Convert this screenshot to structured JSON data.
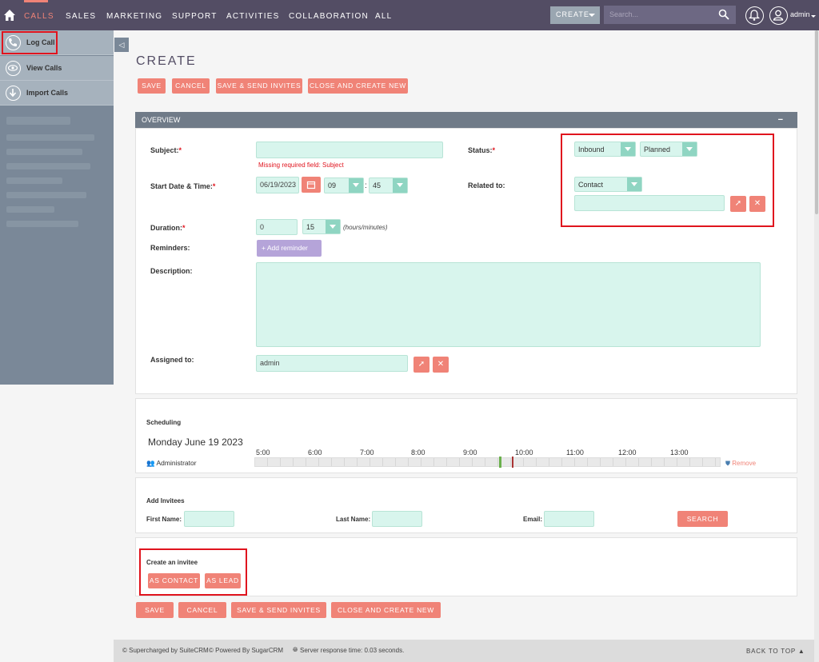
{
  "nav": {
    "items": [
      "CALLS",
      "SALES",
      "MARKETING",
      "SUPPORT",
      "ACTIVITIES",
      "COLLABORATION",
      "ALL"
    ],
    "create_label": "CREATE",
    "search_placeholder": "Search...",
    "user": "admin",
    "accent": "#f08377",
    "bg": "#534d64"
  },
  "sidebar": {
    "items": [
      {
        "label": "Log Call",
        "icon": "phone-icon"
      },
      {
        "label": "View Calls",
        "icon": "eye-icon"
      },
      {
        "label": "Import Calls",
        "icon": "import-icon"
      }
    ]
  },
  "page": {
    "title": "CREATE",
    "top_buttons": [
      "SAVE",
      "CANCEL",
      "SAVE & SEND INVITES",
      "CLOSE AND CREATE NEW"
    ],
    "bottom_buttons": [
      "SAVE",
      "CANCEL",
      "SAVE & SEND INVITES",
      "CLOSE AND CREATE NEW"
    ]
  },
  "overview": {
    "header": "OVERVIEW",
    "collapse_symbol": "−",
    "subject_label": "Subject:",
    "subject_value": "",
    "subject_error": "Missing required field: Subject",
    "start_label": "Start Date & Time:",
    "start_date": "06/19/2023",
    "start_hour": "09",
    "start_minute": "45",
    "duration_label": "Duration:",
    "duration_hours": "0",
    "duration_minutes": "15",
    "duration_unit": "(hours/minutes)",
    "reminders_label": "Reminders:",
    "add_reminder": "Add reminder",
    "description_label": "Description:",
    "description_value": "",
    "assigned_label": "Assigned to:",
    "assigned_value": "admin",
    "status_label": "Status:",
    "status_direction": "Inbound",
    "status_value": "Planned",
    "related_label": "Related to:",
    "related_type": "Contact",
    "related_value": ""
  },
  "scheduling": {
    "title": "Scheduling",
    "date": "Monday June 19 2023",
    "hours": [
      "5:00",
      "6:00",
      "7:00",
      "8:00",
      "9:00",
      "10:00",
      "11:00",
      "12:00",
      "13:00"
    ],
    "attendee": "Administrator",
    "remove_label": "Remove"
  },
  "invitees": {
    "title": "Add Invitees",
    "first_name_label": "First Name:",
    "last_name_label": "Last Name:",
    "email_label": "Email:",
    "search_label": "SEARCH"
  },
  "create_invitee": {
    "title": "Create an invitee",
    "as_contact": "AS CONTACT",
    "as_lead": "AS LEAD"
  },
  "footer": {
    "supercharged": "© Supercharged by SuiteCRM",
    "powered": "© Powered By SugarCRM",
    "server_time": "Server response time: 0.03 seconds.",
    "back_to_top": "BACK TO TOP"
  }
}
